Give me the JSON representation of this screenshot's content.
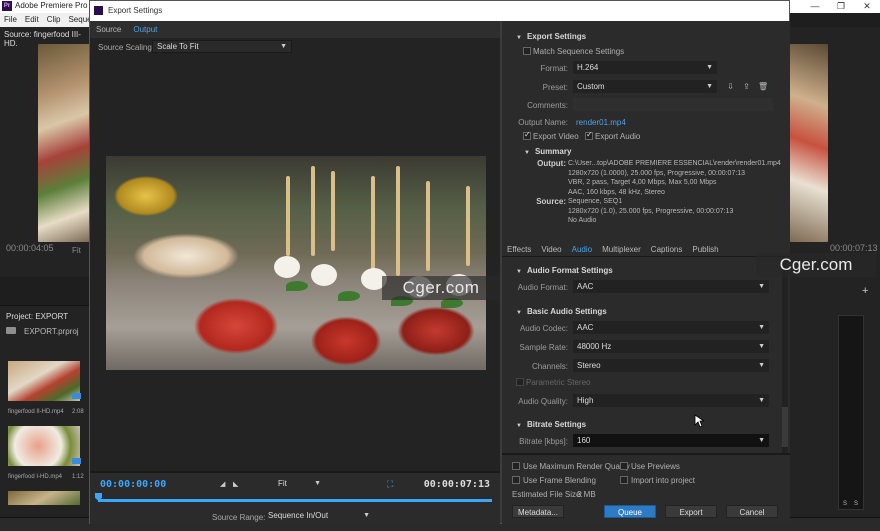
{
  "premiere": {
    "title": "Adobe Premiere Pro CC",
    "logo": "Pr",
    "menu": [
      "File",
      "Edit",
      "Clip",
      "Sequer"
    ],
    "source_label": "Source: fingerfood III-HD.",
    "source_time": "00:00:04:05",
    "source_fit": "Fit",
    "program_time": "00:00:07:13",
    "project_label": "Project: EXPORT",
    "project_file": "EXPORT.prproj",
    "clips": [
      {
        "name": "fingerfood II-HD.mp4",
        "duration": "2:08"
      },
      {
        "name": "fingerfood I-HD.mp4",
        "duration": "1:12"
      }
    ],
    "meter_labels": [
      "S",
      "S"
    ]
  },
  "dialog": {
    "title": "Export Settings",
    "preview": {
      "tabs": [
        "Source",
        "Output"
      ],
      "active_tab": "Output",
      "scaling_label": "Source Scaling:",
      "scaling_value": "Scale To Fit",
      "timecode_in": "00:00:00:00",
      "timecode_out": "00:00:07:13",
      "fit_value": "Fit",
      "source_range_label": "Source Range:",
      "source_range_value": "Sequence In/Out",
      "progress": 0
    },
    "export_settings": {
      "header": "Export Settings",
      "match_sequence": "Match Sequence Settings",
      "format_label": "Format:",
      "format_value": "H.264",
      "preset_label": "Preset:",
      "preset_value": "Custom",
      "comments_label": "Comments:",
      "output_name_label": "Output Name:",
      "output_name_value": "render01.mp4",
      "export_video": "Export Video",
      "export_audio": "Export Audio"
    },
    "summary": {
      "header": "Summary",
      "output_label": "Output:",
      "output_lines": [
        "C:\\User...top\\ADOBE PREMIERE ESSENCIAL\\render\\render01.mp4",
        "1280x720 (1.0000), 25.000 fps, Progressive, 00:00:07:13",
        "VBR, 2 pass, Target 4,00 Mbps, Max 5,00 Mbps",
        "AAC, 160 kbps, 48 kHz, Stereo"
      ],
      "source_label": "Source:",
      "source_lines": [
        "Sequence, SEQ1",
        "1280x720 (1.0), 25.000 fps, Progressive, 00:00:07:13",
        "No Audio"
      ]
    },
    "tabs": [
      "Effects",
      "Video",
      "Audio",
      "Multiplexer",
      "Captions",
      "Publish"
    ],
    "active_tab": "Audio",
    "audio_format": {
      "header": "Audio Format Settings",
      "label": "Audio Format:",
      "value": "AAC"
    },
    "basic_audio": {
      "header": "Basic Audio Settings",
      "codec_label": "Audio Codec:",
      "codec_value": "AAC",
      "sample_rate_label": "Sample Rate:",
      "sample_rate_value": "48000 Hz",
      "channels_label": "Channels:",
      "channels_value": "Stereo",
      "parametric_stereo": "Parametric Stereo",
      "quality_label": "Audio Quality:",
      "quality_value": "High"
    },
    "bitrate": {
      "header": "Bitrate Settings",
      "label": "Bitrate [kbps]:",
      "value": "160"
    },
    "options": {
      "max_render_quality": "Use Maximum Render Quality",
      "use_previews": "Use Previews",
      "frame_blending": "Use Frame Blending",
      "import_into_project": "Import into project",
      "file_size_label": "Estimated File Size:",
      "file_size_value": "3 MB"
    },
    "buttons": {
      "metadata": "Metadata...",
      "queue": "Queue",
      "export": "Export",
      "cancel": "Cancel"
    }
  },
  "watermark": "Cger.com",
  "colors": {
    "accent": "#3aa6ff",
    "link": "#4da3e8",
    "primary_button": "#2d7bc4"
  }
}
